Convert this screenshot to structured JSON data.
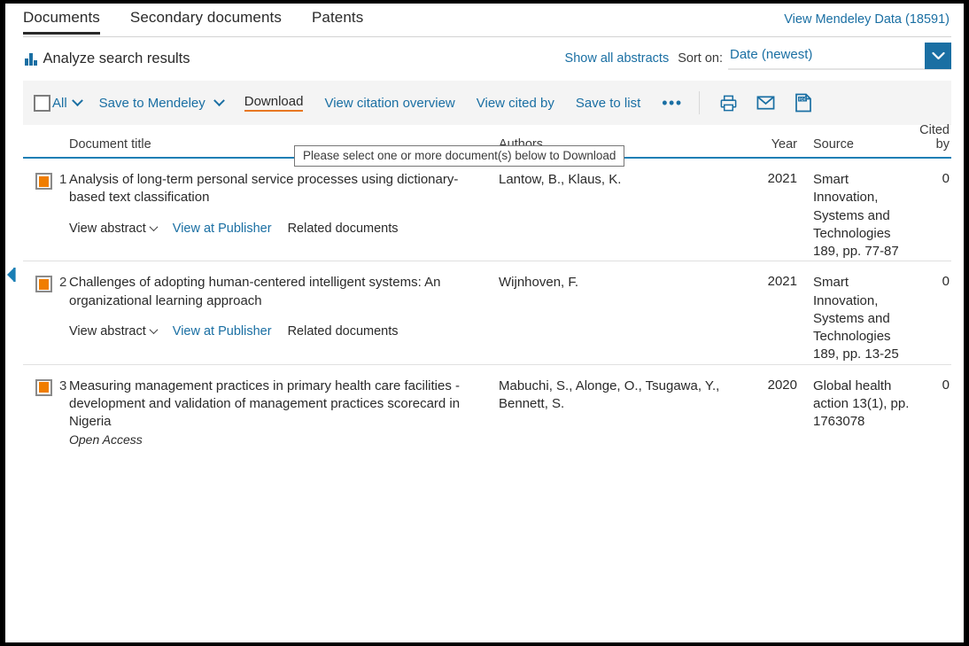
{
  "tabs": [
    {
      "label": "Documents",
      "active": true
    },
    {
      "label": "Secondary documents",
      "active": false
    },
    {
      "label": "Patents",
      "active": false
    }
  ],
  "header": {
    "mendeley_link": "View Mendeley Data (18591)"
  },
  "analyze": {
    "label": "Analyze search results",
    "icon": "bar-chart-icon",
    "show_abstracts": "Show all abstracts",
    "sort_label": "Sort on:",
    "sort_value": "Date (newest)"
  },
  "toolbar": {
    "all_label": "All",
    "save_to_mendeley": "Save to Mendeley",
    "download": "Download",
    "view_citation_overview": "View citation overview",
    "view_cited_by": "View cited by",
    "save_to_list": "Save to list",
    "more": "•••",
    "print_icon": "print-icon",
    "email_icon": "email-icon",
    "pdf_icon": "pdf-icon"
  },
  "tooltip": {
    "text": "Please select one or more document(s) below to Download"
  },
  "columns": {
    "title": "Document title",
    "authors": "Authors",
    "year": "Year",
    "source": "Source",
    "cited_by": "Cited by"
  },
  "row_links": {
    "view_abstract": "View abstract",
    "view_at_publisher": "View at Publisher",
    "related_documents": "Related documents"
  },
  "results": [
    {
      "num": "1",
      "title": "Analysis of long-term personal service processes using dictionary-based text classification",
      "open_access": "",
      "authors": "Lantow, B., Klaus, K.",
      "year": "2021",
      "source": "Smart Innovation, Systems and Technologies 189, pp. 77-87",
      "cited_by": "0"
    },
    {
      "num": "2",
      "title": "Challenges of adopting human-centered intelligent systems: An organizational learning approach",
      "open_access": "",
      "authors": "Wijnhoven, F.",
      "year": "2021",
      "source": "Smart Innovation, Systems and Technologies 189, pp. 13-25",
      "cited_by": "0"
    },
    {
      "num": "3",
      "title": "Measuring management practices in primary health care facilities - development and validation of management practices scorecard in Nigeria",
      "open_access": "Open Access",
      "authors": "Mabuchi, S., Alonge, O., Tsugawa, Y., Bennett, S.",
      "year": "2020",
      "source": "Global health action 13(1), pp. 1763078",
      "cited_by": "0"
    }
  ],
  "colors": {
    "link": "#1a6fa3",
    "accent_orange": "#e87722",
    "marker_orange": "#f07d00",
    "rule_blue": "#1a7fb5",
    "toolbar_bg": "#f4f4f4"
  }
}
